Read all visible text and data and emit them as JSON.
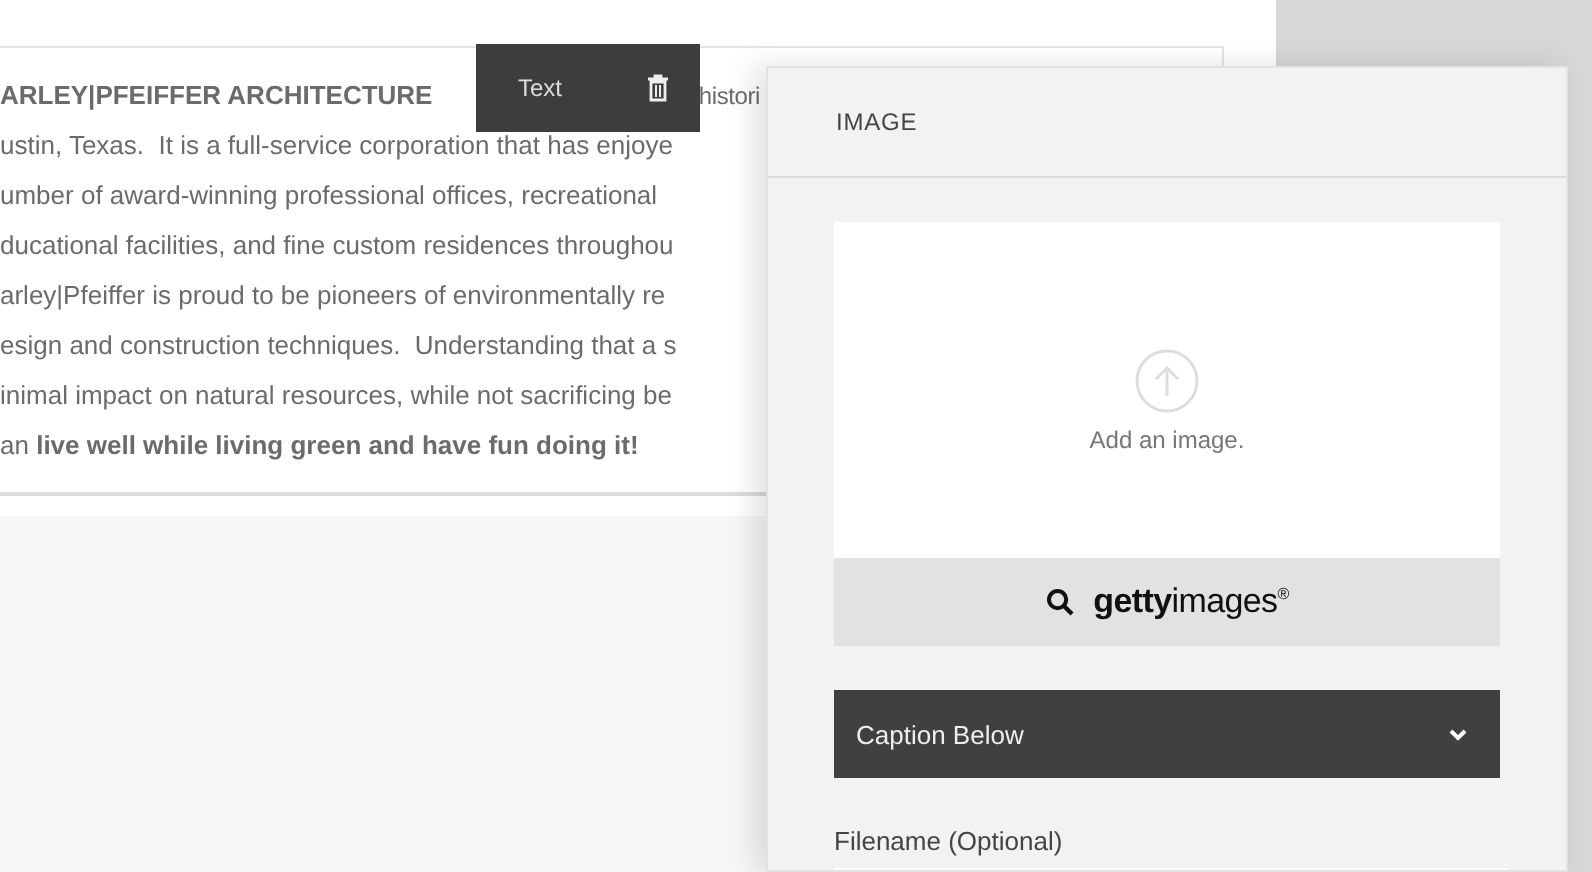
{
  "text_block": {
    "lines": [
      {
        "text": "ARLEY|PFEIFFER ARCHITECTURE",
        "bold": true,
        "tail": "histori"
      },
      {
        "text": "ustin, Texas.  It is a full-service corporation that has enjoye",
        "bold": false
      },
      {
        "text": "umber of award-winning professional offices, recreational",
        "bold": false
      },
      {
        "text": "ducational facilities, and fine custom residences throughou",
        "bold": false
      },
      {
        "text": "arley|Pfeiffer is proud to be pioneers of environmentally re",
        "bold": false
      },
      {
        "text": "esign and construction techniques.  Understanding that a s",
        "bold": false
      },
      {
        "text": "inimal impact on natural resources, while not sacrificing be",
        "bold": false
      },
      {
        "text": "an **live well while living green and have fun doing it!**",
        "bold": false
      }
    ]
  },
  "editor_toolbar": {
    "label": "Text"
  },
  "image_panel": {
    "title": "IMAGE",
    "upload": {
      "label": "Add an image."
    },
    "stock_search": {
      "brand": "**getty**images$^{®}$"
    },
    "caption_select": {
      "value": "Caption Below"
    },
    "filename_field": {
      "label": "Filename (Optional)"
    }
  }
}
